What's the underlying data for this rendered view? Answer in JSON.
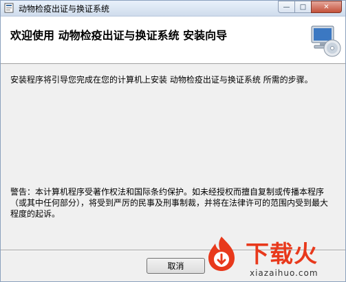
{
  "window": {
    "title": "动物检疫出证与换证系统",
    "controls": {
      "minimize": "—",
      "maximize": "□",
      "close": "✕"
    }
  },
  "header": {
    "title": "欢迎使用 动物检疫出证与换证系统 安装向导",
    "graphic_icon": "computer-cd-icon"
  },
  "body": {
    "description": "安装程序将引导您完成在您的计算机上安装 动物检疫出证与换证系统 所需的步骤。",
    "warning": "警告：本计算机程序受著作权法和国际条约保护。如未经授权而擅自复制或传播本程序（或其中任何部分），将受到严厉的民事及刑事制裁，并将在法律许可的范围内受到最大程度的起诉。"
  },
  "footer": {
    "cancel_label": "取消"
  },
  "watermark": {
    "brand": "下载火",
    "url": "xiazaihuo.com",
    "colors": {
      "brand": "#e8391c"
    }
  }
}
